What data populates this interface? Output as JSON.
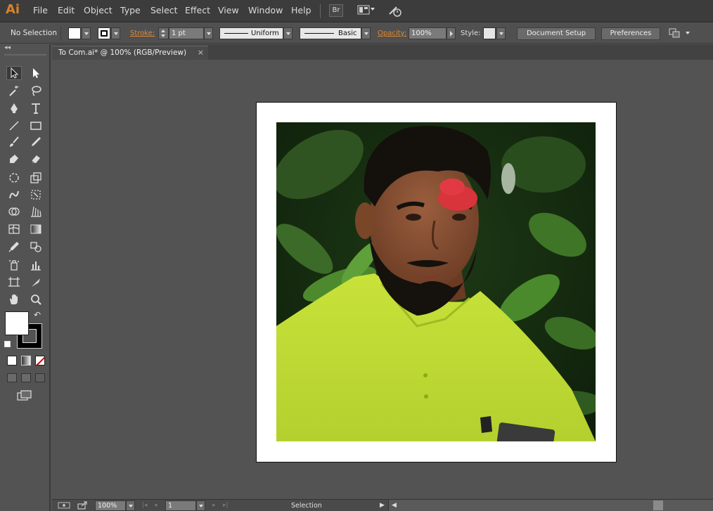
{
  "app": {
    "logo": "Ai"
  },
  "menu": [
    "File",
    "Edit",
    "Object",
    "Type",
    "Select",
    "Effect",
    "View",
    "Window",
    "Help"
  ],
  "toolbar_buttons": {
    "bridge": "Br"
  },
  "control": {
    "selection_status": "No Selection",
    "stroke_label": "Stroke:",
    "stroke_weight": "1 pt",
    "profile": "Uniform",
    "brush": "Basic",
    "opacity_label": "Opacity:",
    "opacity_value": "100%",
    "style_label": "Style:",
    "document_setup": "Document Setup",
    "preferences": "Preferences"
  },
  "document_tab": {
    "title": "To Com.ai* @ 100% (RGB/Preview)",
    "close": "×"
  },
  "status_bar": {
    "zoom": "100%",
    "artboard_number": "1",
    "mode": "Selection"
  },
  "colors": {
    "accent": "#d9822b",
    "canvas": "#535353",
    "panel": "#505050",
    "menubar": "#3c3c3c"
  },
  "icons": [
    "selection-icon",
    "direct-selection-icon",
    "magic-wand-icon",
    "lasso-icon",
    "pen-icon",
    "type-icon",
    "line-segment-icon",
    "rectangle-icon",
    "paintbrush-icon",
    "pencil-icon",
    "blob-brush-icon",
    "eraser-icon",
    "rotate-icon",
    "scale-icon",
    "warp-icon",
    "free-transform-icon",
    "shape-builder-icon",
    "perspective-grid-icon",
    "mesh-icon",
    "gradient-icon",
    "eyedropper-icon",
    "blend-icon",
    "symbol-sprayer-icon",
    "column-graph-icon",
    "artboard-icon",
    "slice-icon",
    "hand-icon",
    "zoom-icon"
  ]
}
